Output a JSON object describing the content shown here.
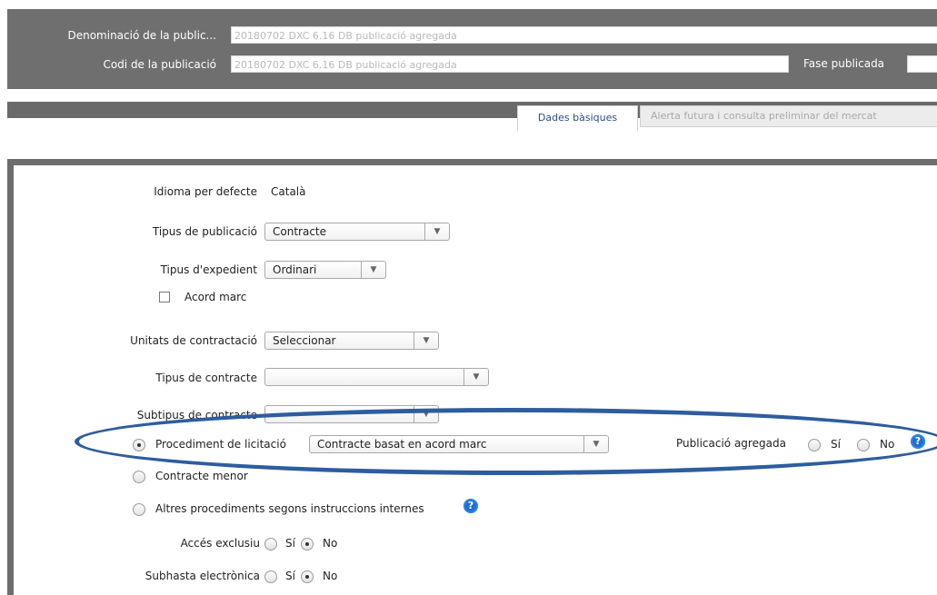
{
  "header": {
    "denominacio_label": "Denominació de la public...",
    "denominacio_value": "20180702 DXC 6.16 DB publicació agregada",
    "codi_label": "Codi de la publicació",
    "codi_value": "20180702 DXC 6.16 DB publicació agregada",
    "fase_label": "Fase publicada"
  },
  "tabs": [
    {
      "label": "Dades bàsiques",
      "active": true
    },
    {
      "label": "Alerta futura i consulta preliminar del mercat",
      "active": false
    }
  ],
  "form": {
    "idioma_label": "Idioma per defecte",
    "idioma_value": "Català",
    "tipus_publicacio_label": "Tipus de publicació",
    "tipus_publicacio_value": "Contracte",
    "tipus_expedient_label": "Tipus d'expedient",
    "tipus_expedient_value": "Ordinari",
    "acord_marc_label": "Acord marc",
    "acord_marc_checked": false,
    "unitats_label": "Unitats de contractació",
    "unitats_value": "Seleccionar",
    "tipus_contracte_label": "Tipus de contracte",
    "tipus_contracte_value": "",
    "subtipus_label": "Subtipus de contracte",
    "subtipus_value": "",
    "procediment_label": "Procediment de licitació",
    "procediment_value": "Contracte basat en acord marc",
    "procediment_selected": true,
    "publicacio_agregada_label": "Publicació agregada",
    "si_label": "Sí",
    "no_label": "No",
    "contracte_menor_label": "Contracte menor",
    "altres_label": "Altres procediments segons instruccions internes",
    "acces_exclusiu_label": "Accés exclusiu",
    "acces_exclusiu_value": "No",
    "subhasta_label": "Subhasta electrònica",
    "subhasta_value": "No",
    "help_glyph": "?"
  },
  "colors": {
    "header_bg": "#6f6f6f",
    "tab_text": "#2b4f7e",
    "annotation": "#2e5d9e",
    "help_icon": "#1f6fd1"
  }
}
